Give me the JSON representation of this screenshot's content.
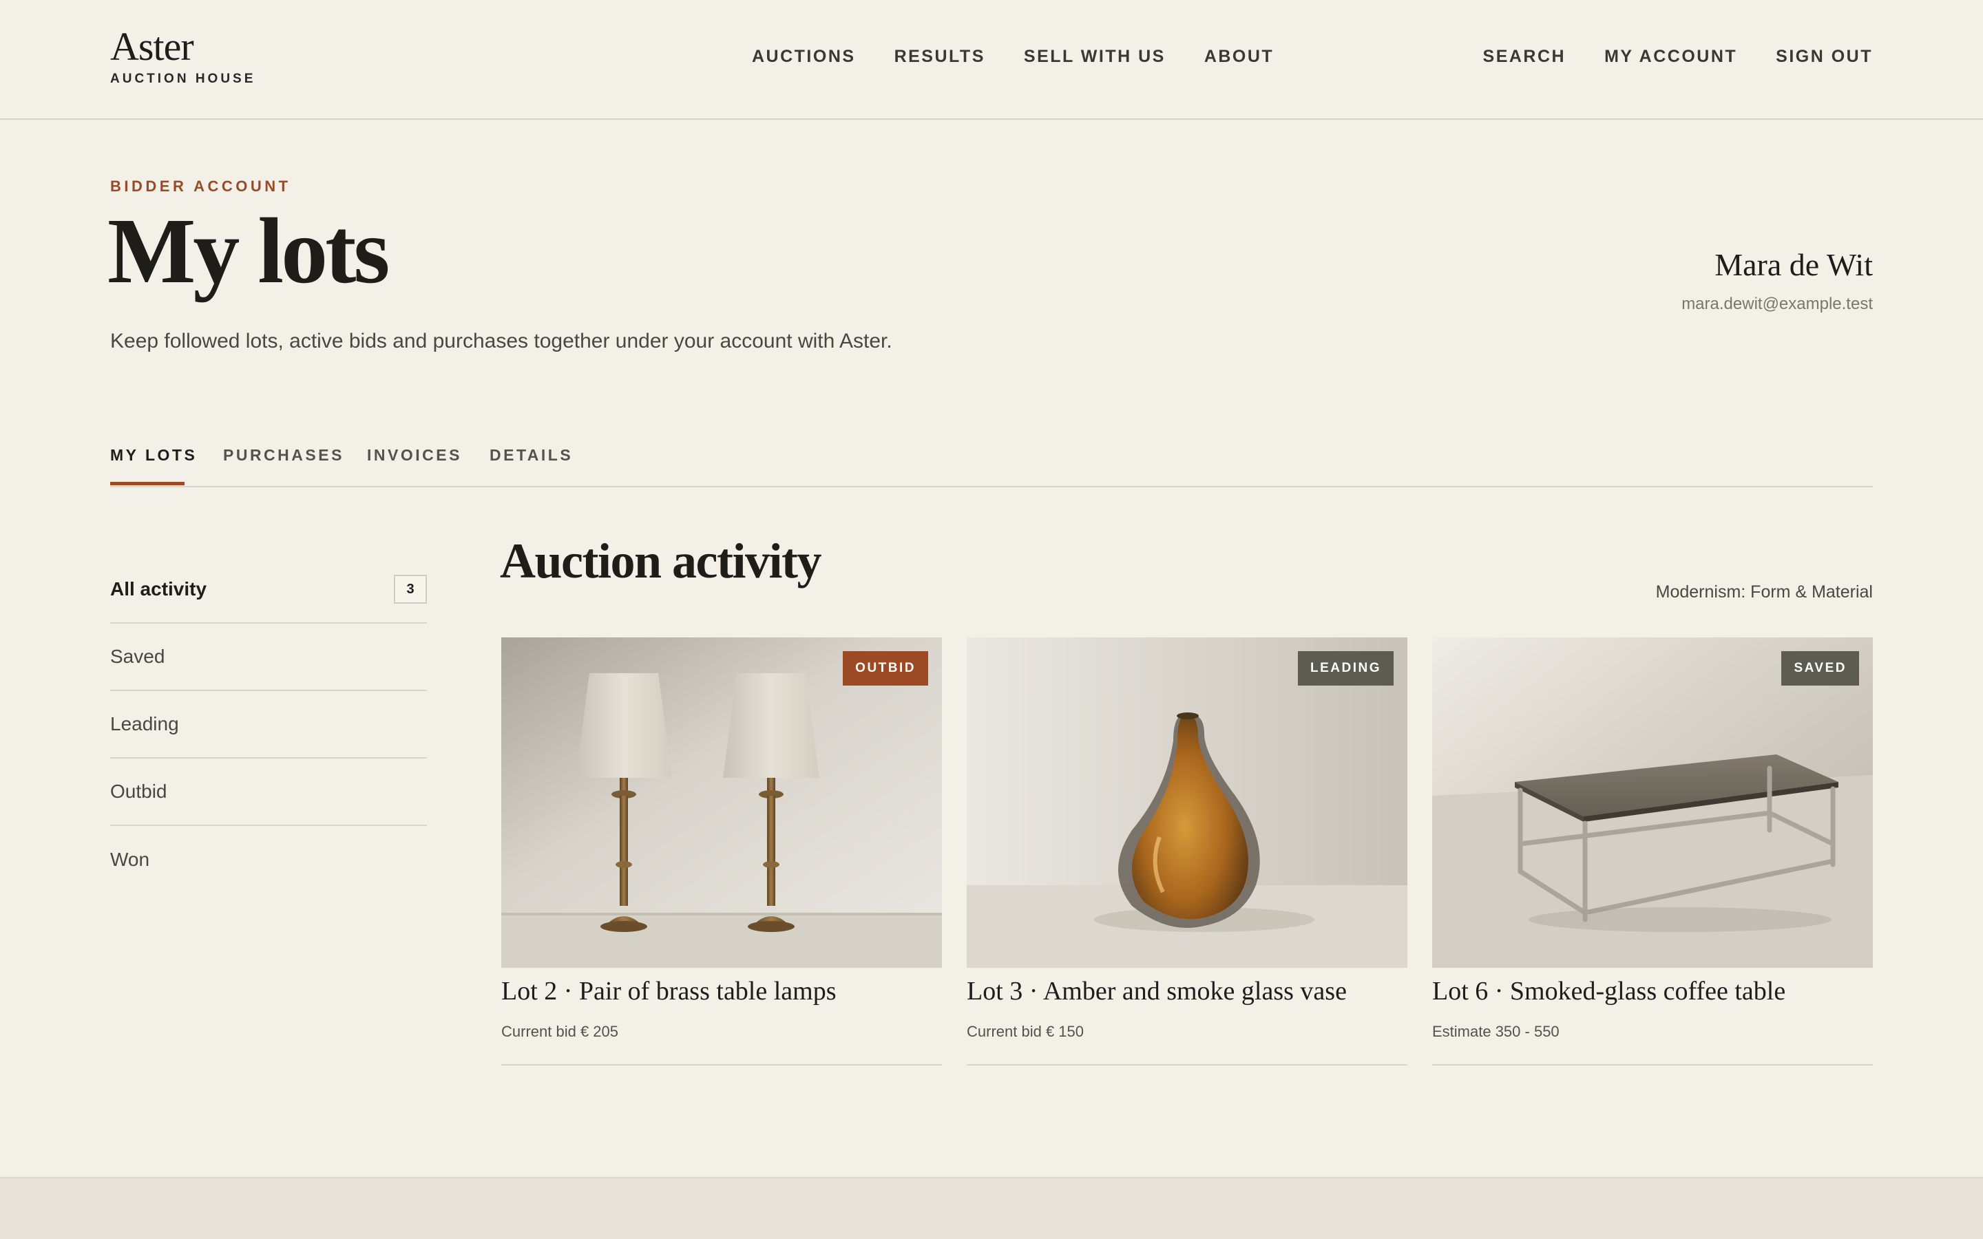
{
  "header": {
    "logo_name": "Aster",
    "logo_sub": "AUCTION HOUSE",
    "nav_main": [
      "AUCTIONS",
      "RESULTS",
      "SELL WITH US",
      "ABOUT"
    ],
    "nav_right": [
      "SEARCH",
      "MY ACCOUNT",
      "SIGN OUT"
    ]
  },
  "page": {
    "eyebrow": "BIDDER ACCOUNT",
    "title": "My lots",
    "intro": "Keep followed lots, active bids and purchases together under your account with Aster."
  },
  "user": {
    "name": "Mara de Wit",
    "email": "mara.dewit@example.test"
  },
  "tabs": {
    "items": [
      "MY LOTS",
      "PURCHASES",
      "INVOICES",
      "DETAILS"
    ],
    "active": "MY LOTS"
  },
  "sidebar": {
    "items": [
      {
        "label": "All activity",
        "count": "3",
        "active": true
      },
      {
        "label": "Saved"
      },
      {
        "label": "Leading"
      },
      {
        "label": "Outbid"
      },
      {
        "label": "Won"
      }
    ]
  },
  "section": {
    "title": "Auction activity",
    "meta": "Modernism: Form & Material"
  },
  "lots": [
    {
      "title": "Lot 2 · Pair of brass table lamps",
      "subtitle": "Current bid € 205",
      "status": "OUTBID",
      "status_color": "#9c4a26",
      "image": "brass-lamps-image"
    },
    {
      "title": "Lot 3 · Amber and smoke glass vase",
      "subtitle": "Current bid € 150",
      "status": "LEADING",
      "status_color": "#5c5c50",
      "image": "amber-vase-image"
    },
    {
      "title": "Lot 6 · Smoked-glass coffee table",
      "subtitle": "Estimate 350 - 550",
      "status": "SAVED",
      "status_color": "#5c5c50",
      "image": "coffee-table-image"
    }
  ],
  "colors": {
    "background": "#f3f0e7",
    "accent": "#9c4a26",
    "text": "#1f1d1a"
  }
}
